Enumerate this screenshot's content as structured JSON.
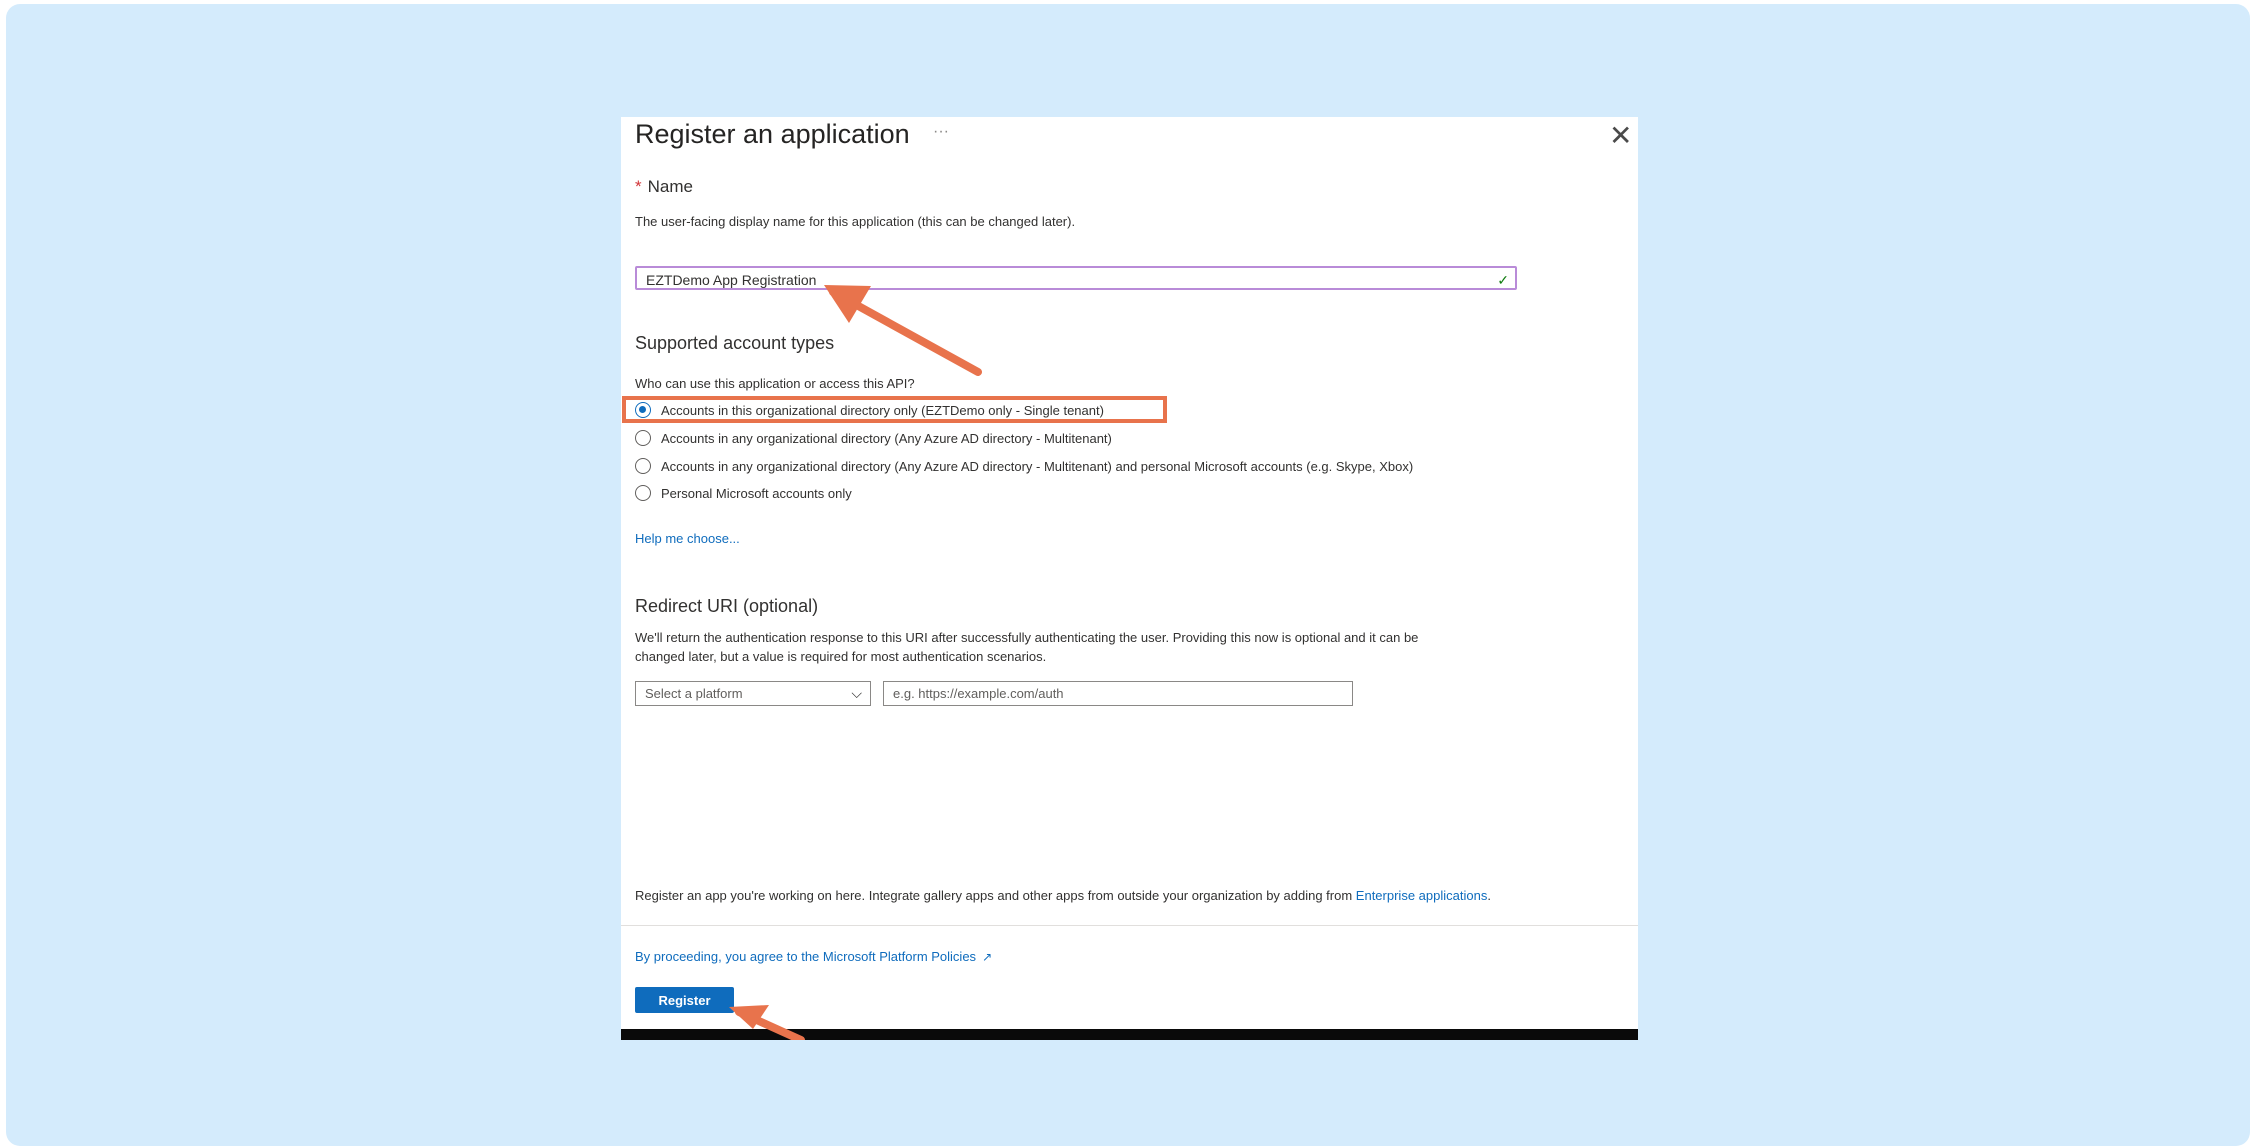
{
  "dialog": {
    "title": "Register an application",
    "more_label": "···",
    "close_label": "✕"
  },
  "name": {
    "label": "Name",
    "required_marker": "*",
    "description": "The user-facing display name for this application (this can be changed later).",
    "value": "EZTDemo App Registration",
    "valid_icon": "checkmark-icon"
  },
  "account_types": {
    "heading": "Supported account types",
    "question": "Who can use this application or access this API?",
    "options": [
      {
        "label": "Accounts in this organizational directory only (EZTDemo only - Single tenant)",
        "selected": true
      },
      {
        "label": "Accounts in any organizational directory (Any Azure AD directory - Multitenant)",
        "selected": false
      },
      {
        "label": "Accounts in any organizational directory (Any Azure AD directory - Multitenant) and personal Microsoft accounts (e.g. Skype, Xbox)",
        "selected": false
      },
      {
        "label": "Personal Microsoft accounts only",
        "selected": false
      }
    ],
    "help_link": "Help me choose..."
  },
  "redirect": {
    "heading": "Redirect URI (optional)",
    "description_line1": "We'll return the authentication response to this URI after successfully authenticating the user. Providing this now is optional and it can be",
    "description_line2": "changed later, but a value is required for most authentication scenarios.",
    "platform_placeholder": "Select a platform",
    "uri_placeholder": "e.g. https://example.com/auth"
  },
  "footer": {
    "text": "Register an app you're working on here. Integrate gallery apps and other apps from outside your organization by adding from ",
    "link": "Enterprise applications",
    "period": ".",
    "policy_link": "By proceeding, you agree to the Microsoft Platform Policies",
    "register_label": "Register"
  },
  "colors": {
    "background": "#d4ebfc",
    "accent": "#0f6cbd",
    "annotation": "#e8734c"
  }
}
